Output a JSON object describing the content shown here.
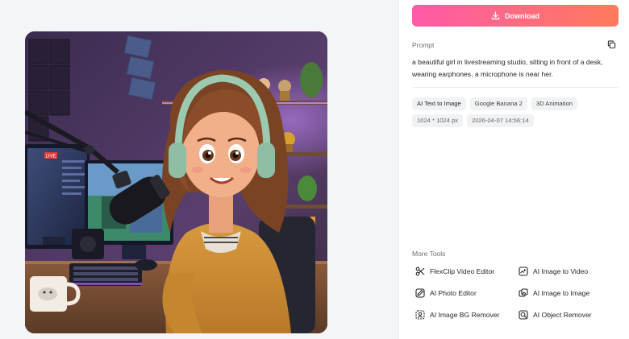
{
  "download": {
    "label": "Download"
  },
  "prompt": {
    "label": "Prompt",
    "text": "a beautiful girl in livestreaming studio, sitting in front of a desk, wearing earphones, a microphone is near her."
  },
  "tags": [
    {
      "label": "AI Text to Image"
    },
    {
      "label": "Google Banana 2"
    },
    {
      "label": "3D Animation"
    },
    {
      "label": "1024 * 1024 px"
    },
    {
      "label": "2026-04-07 14:56:14"
    }
  ],
  "monitor_badge": "LIVE",
  "more_tools": {
    "label": "More Tools",
    "items": [
      {
        "label": "FlexClip Video Editor",
        "icon": "scissors-icon"
      },
      {
        "label": "AI Image to Video",
        "icon": "image-to-video-icon"
      },
      {
        "label": "AI Photo Editor",
        "icon": "photo-edit-icon"
      },
      {
        "label": "AI Image to Image",
        "icon": "image-to-image-icon"
      },
      {
        "label": "AI Image BG Remover",
        "icon": "bg-remover-icon"
      },
      {
        "label": "AI Object Remover",
        "icon": "object-remover-icon"
      }
    ]
  },
  "colors": {
    "download_gradient_start": "#ff5aa8",
    "download_gradient_end": "#ff7a5c",
    "panel_bg": "#ffffff",
    "page_bg": "#f4f5f7"
  }
}
